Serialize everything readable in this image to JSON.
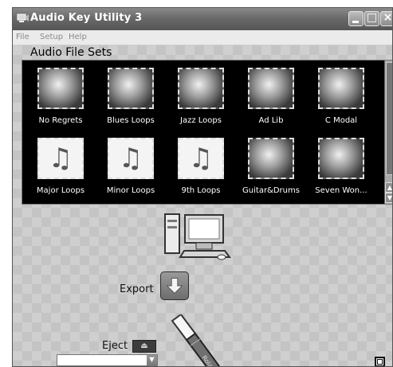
{
  "window": {
    "title": "Audio Key Utility 3"
  },
  "menu": {
    "items": [
      "File",
      "Setup",
      "Help"
    ]
  },
  "gallery": {
    "title": "Audio File Sets",
    "items": [
      {
        "label": "No Regrets",
        "icon": "photo-thumbnail-icon"
      },
      {
        "label": "Blues Loops",
        "icon": "photo-thumbnail-icon"
      },
      {
        "label": "Jazz Loops",
        "icon": "photo-thumbnail-icon"
      },
      {
        "label": "Ad Lib",
        "icon": "photo-thumbnail-icon"
      },
      {
        "label": "C Modal",
        "icon": "photo-thumbnail-icon"
      },
      {
        "label": "Major Loops",
        "icon": "music-notes-icon"
      },
      {
        "label": "Minor Loops",
        "icon": "music-notes-icon"
      },
      {
        "label": "9th Loops",
        "icon": "music-notes-icon"
      },
      {
        "label": "Guitar&Drums",
        "icon": "photo-thumbnail-icon"
      },
      {
        "label": "Seven Won...",
        "icon": "photo-thumbnail-icon"
      }
    ]
  },
  "actions": {
    "export_label": "Export",
    "eject_label": "Eject"
  },
  "drive": {
    "selected_value": ""
  }
}
